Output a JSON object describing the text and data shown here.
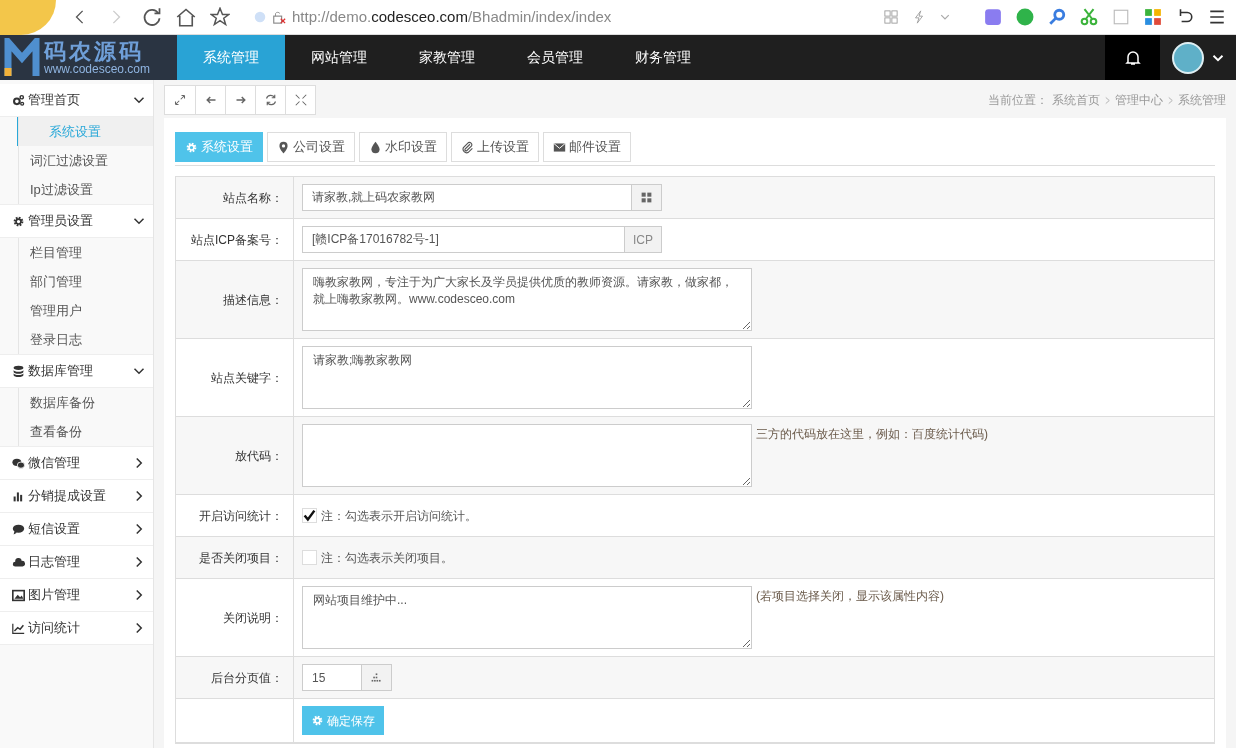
{
  "browser": {
    "url_prefix": "http://demo.",
    "url_domain": "codesceo.com",
    "url_path": "/Bhadmin/index/index"
  },
  "header": {
    "logo_title": "码农源码",
    "logo_subtitle": "www.codesceo.com",
    "nav": [
      {
        "label": "系统管理",
        "selected": true
      },
      {
        "label": "网站管理",
        "selected": false
      },
      {
        "label": "家教管理",
        "selected": false
      },
      {
        "label": "会员管理",
        "selected": false
      },
      {
        "label": "财务管理",
        "selected": false
      }
    ]
  },
  "sidebar": {
    "groups": [
      {
        "label": "管理首页",
        "expanded": true,
        "children": [
          {
            "label": "系统设置",
            "selected": true
          },
          {
            "label": "词汇过滤设置",
            "selected": false
          },
          {
            "label": "Ip过滤设置",
            "selected": false
          }
        ]
      },
      {
        "label": "管理员设置",
        "expanded": true,
        "children": [
          {
            "label": "栏目管理",
            "selected": false
          },
          {
            "label": "部门管理",
            "selected": false
          },
          {
            "label": "管理用户",
            "selected": false
          },
          {
            "label": "登录日志",
            "selected": false
          }
        ]
      },
      {
        "label": "数据库管理",
        "expanded": true,
        "children": [
          {
            "label": "数据库备份",
            "selected": false
          },
          {
            "label": "查看备份",
            "selected": false
          }
        ]
      },
      {
        "label": "微信管理",
        "expanded": false
      },
      {
        "label": "分销提成设置",
        "expanded": false
      },
      {
        "label": "短信设置",
        "expanded": false
      },
      {
        "label": "日志管理",
        "expanded": false
      },
      {
        "label": "图片管理",
        "expanded": false
      },
      {
        "label": "访问统计",
        "expanded": false
      }
    ]
  },
  "breadcrumb": {
    "label": "当前位置：",
    "items": [
      "系统首页",
      "管理中心",
      "系统管理"
    ]
  },
  "tabs": [
    {
      "label": "系统设置",
      "selected": true
    },
    {
      "label": "公司设置",
      "selected": false
    },
    {
      "label": "水印设置",
      "selected": false
    },
    {
      "label": "上传设置",
      "selected": false
    },
    {
      "label": "邮件设置",
      "selected": false
    }
  ],
  "form": [
    {
      "kind": "input",
      "label": "站点名称：",
      "value": "请家教,就上码农家教网"
    },
    {
      "kind": "input",
      "label": "站点ICP备案号：",
      "value": "[赣ICP备17016782号-1]",
      "addon_text": "ICP"
    },
    {
      "kind": "textarea",
      "label": "描述信息：",
      "value": "嗨教家教网，专注于为广大家长及学员提供优质的教师资源。请家教，做家都，就上嗨教家教网。www.codesceo.com"
    },
    {
      "kind": "textarea",
      "label": "站点关键字：",
      "value": "请家教;嗨教家教网"
    },
    {
      "kind": "textarea",
      "label": "放代码：",
      "hint": "三方的代码放在这里，例如：百度统计代码)"
    },
    {
      "kind": "checkbox",
      "label": "开启访问统计：",
      "checked": true,
      "note": "注：勾选表示开启访问统计。"
    },
    {
      "kind": "checkbox",
      "label": "是否关闭项目：",
      "checked": false,
      "note": "注：勾选表示关闭项目。"
    },
    {
      "kind": "textarea",
      "label": "关闭说明：",
      "value": "网站项目维护中...",
      "hint": "(若项目选择关闭，显示该属性内容)"
    },
    {
      "kind": "number",
      "label": "后台分页值：",
      "value": "15"
    },
    {
      "kind": "submit",
      "button": "确定保存"
    }
  ]
}
